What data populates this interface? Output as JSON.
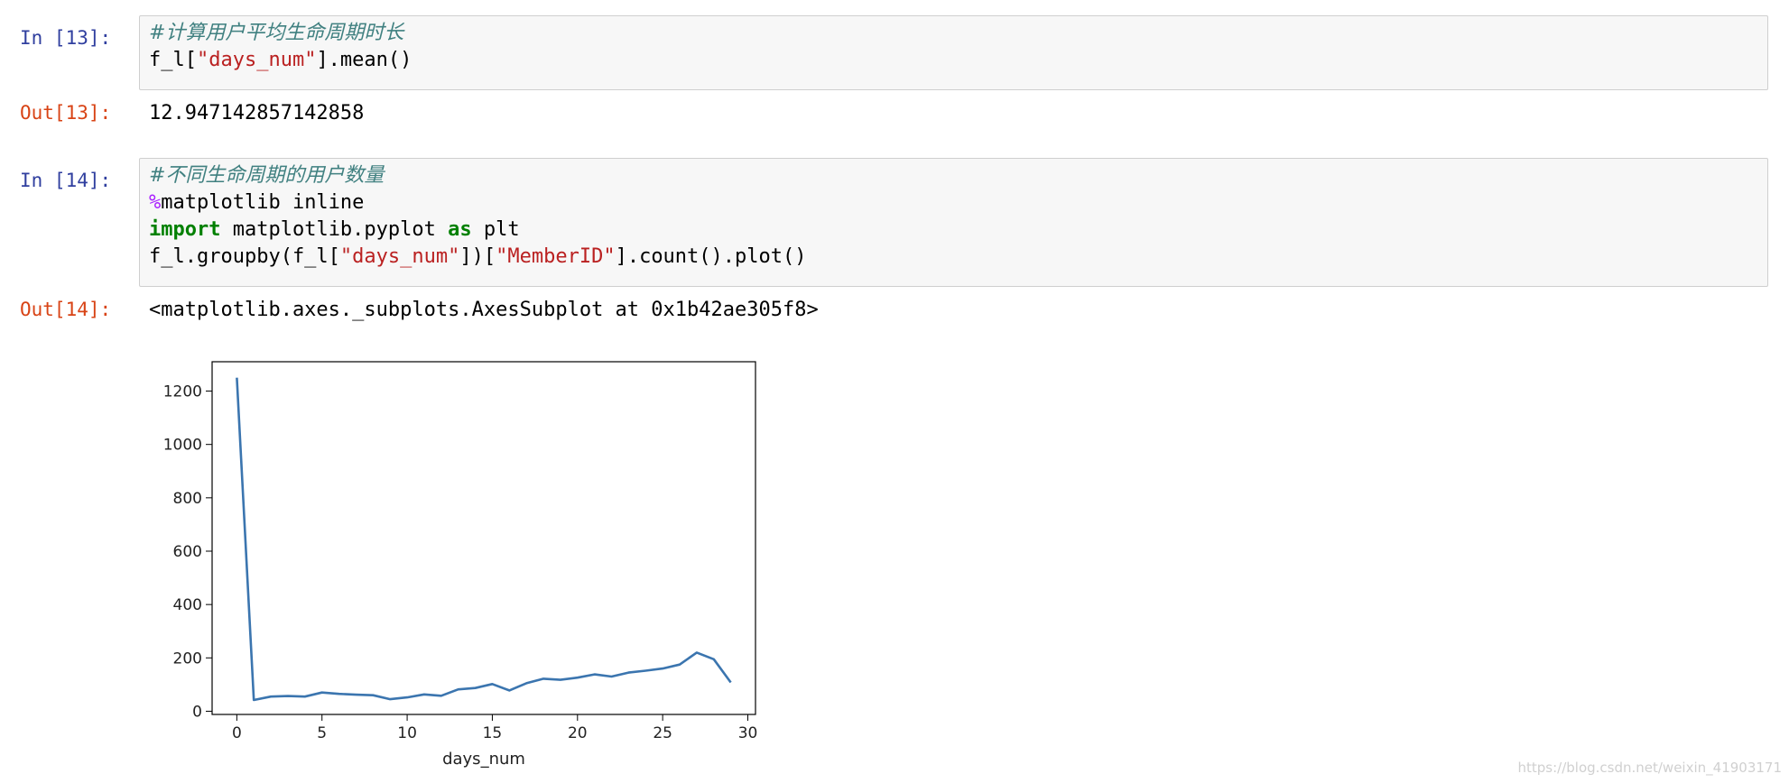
{
  "cells": [
    {
      "in_prompt": "In [13]:",
      "code": {
        "comment": "#计算用户平均生命周期时长",
        "line2_a": "f_l[",
        "line2_str": "\"days_num\"",
        "line2_b": "].mean()"
      },
      "out_prompt": "Out[13]:",
      "output": "12.947142857142858"
    },
    {
      "in_prompt": "In [14]:",
      "code": {
        "comment": "#不同生命周期的用户数量",
        "magic_sym": "%",
        "magic_rest": "matplotlib inline",
        "kw_import": "import",
        "import_mid": " matplotlib.pyplot ",
        "kw_as": "as",
        "import_end": " plt",
        "line4_a": "f_l.groupby(f_l[",
        "line4_str1": "\"days_num\"",
        "line4_b": "])[",
        "line4_str2": "\"MemberID\"",
        "line4_c": "].count().plot()"
      },
      "out_prompt": "Out[14]:",
      "output": "<matplotlib.axes._subplots.AxesSubplot at 0x1b42ae305f8>"
    }
  ],
  "watermark": "https://blog.csdn.net/weixin_41903171",
  "chart_data": {
    "type": "line",
    "xlabel": "days_num",
    "ylabel": "",
    "xlim": [
      -1.45,
      30.45
    ],
    "ylim": [
      -12,
      1310
    ],
    "xticks": [
      0,
      5,
      10,
      15,
      20,
      25,
      30
    ],
    "yticks": [
      0,
      200,
      400,
      600,
      800,
      1000,
      1200
    ],
    "line_color": "#3b75af",
    "x": [
      0,
      1,
      2,
      3,
      4,
      5,
      6,
      7,
      8,
      9,
      10,
      11,
      12,
      13,
      14,
      15,
      16,
      17,
      18,
      19,
      20,
      21,
      22,
      23,
      24,
      25,
      26,
      27,
      28,
      29
    ],
    "values": [
      1250,
      42,
      55,
      57,
      55,
      70,
      65,
      62,
      60,
      45,
      52,
      63,
      58,
      82,
      87,
      102,
      78,
      105,
      122,
      118,
      126,
      138,
      130,
      145,
      152,
      160,
      175,
      220,
      195,
      108
    ]
  }
}
